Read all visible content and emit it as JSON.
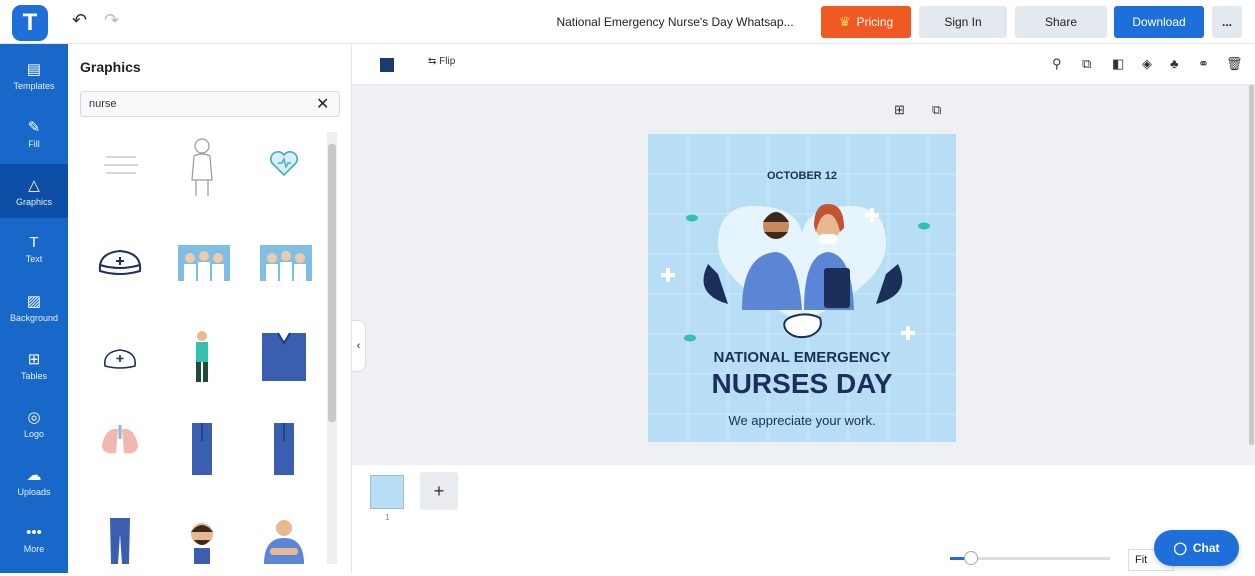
{
  "app": {
    "logo_letter": "T",
    "doc_title": "National Emergency Nurse's Day Whatsap..."
  },
  "header": {
    "pricing": "Pricing",
    "signin": "Sign In",
    "share": "Share",
    "download": "Download",
    "more": "..."
  },
  "rail": [
    {
      "label": "Templates",
      "icon": "templates-icon",
      "glyph": "▤"
    },
    {
      "label": "Fill",
      "icon": "brush-icon",
      "glyph": "✎"
    },
    {
      "label": "Graphics",
      "icon": "shapes-icon",
      "glyph": "△"
    },
    {
      "label": "Text",
      "icon": "text-icon",
      "glyph": "T"
    },
    {
      "label": "Background",
      "icon": "background-icon",
      "glyph": "▨"
    },
    {
      "label": "Tables",
      "icon": "table-icon",
      "glyph": "⊞"
    },
    {
      "label": "Logo",
      "icon": "logo-icon",
      "glyph": "◎"
    },
    {
      "label": "Uploads",
      "icon": "upload-cloud-icon",
      "glyph": "☁"
    },
    {
      "label": "More",
      "icon": "more-dots-icon",
      "glyph": "•••"
    }
  ],
  "panel": {
    "title": "Graphics",
    "search_value": "nurse"
  },
  "toolbar": {
    "flip": "Flip"
  },
  "card": {
    "date": "OCTOBER 12",
    "line1": "NATIONAL EMERGENCY",
    "line2": "NURSES DAY",
    "line3": "We appreciate your work.",
    "bg": "#b7def4",
    "navy": "#1b2f5a"
  },
  "pages": {
    "page_number": "1"
  },
  "zoom": {
    "fit_label": "Fit"
  },
  "chat": {
    "label": "Chat"
  }
}
